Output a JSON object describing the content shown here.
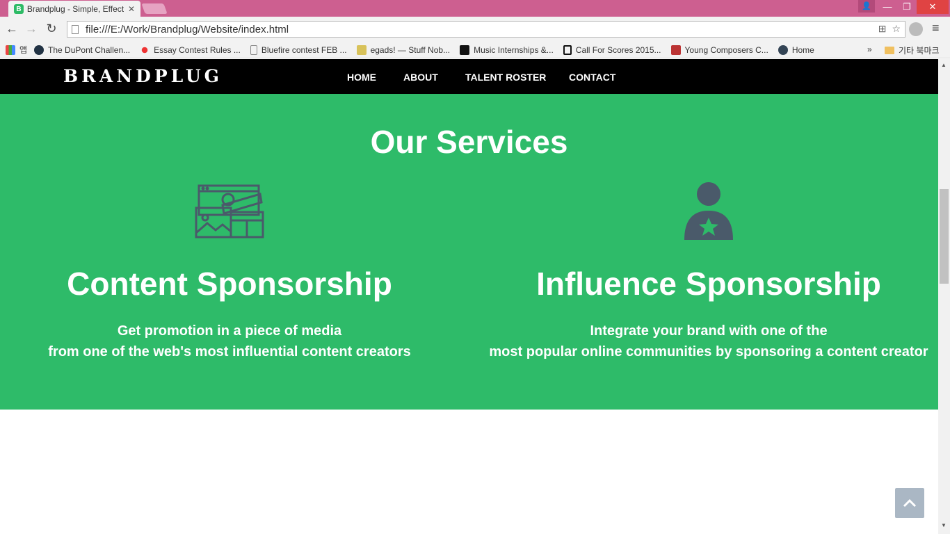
{
  "browser": {
    "tab_title": "Brandplug - Simple, Effect",
    "tab_favicon_letter": "B",
    "url": "file:///E:/Work/Brandplug/Website/index.html",
    "bookmarks": [
      {
        "label": "앱",
        "icon": "apps-grid-icon"
      },
      {
        "label": "The DuPont Challen...",
        "icon": "star-badge-icon"
      },
      {
        "label": "Essay Contest Rules ...",
        "icon": "red-dots-icon"
      },
      {
        "label": "Bluefire contest FEB ...",
        "icon": "page-icon"
      },
      {
        "label": "egads! — Stuff Nob...",
        "icon": "doodle-icon"
      },
      {
        "label": "Music Internships &...",
        "icon": "music-bars-icon"
      },
      {
        "label": "Call For Scores 2015...",
        "icon": "b-logo-icon"
      },
      {
        "label": "Young Composers C...",
        "icon": "bird-icon"
      },
      {
        "label": "Home",
        "icon": "kiwanis-icon"
      }
    ],
    "bookmarks_more": "»",
    "other_bookmarks": "기타 북마크"
  },
  "site": {
    "brand": "BRANDPLUG",
    "nav": [
      "HOME",
      "ABOUT",
      "TALENT ROSTER",
      "CONTACT"
    ]
  },
  "services": {
    "title": "Our Services",
    "items": [
      {
        "icon": "media-clapperboard-icon",
        "heading": "Content Sponsorship",
        "line1": "Get promotion in a piece of media",
        "line2": "from one of the web's most influential content creators"
      },
      {
        "icon": "user-star-icon",
        "heading": "Influence Sponsorship",
        "line1": "Integrate your brand with one of the",
        "line2": "most popular online communities by sponsoring a content creator"
      }
    ]
  },
  "colors": {
    "titlebar": "#cd5f90",
    "services_bg": "#2ebb69",
    "icon_color": "#4a5a6a",
    "navbar": "#000000"
  }
}
